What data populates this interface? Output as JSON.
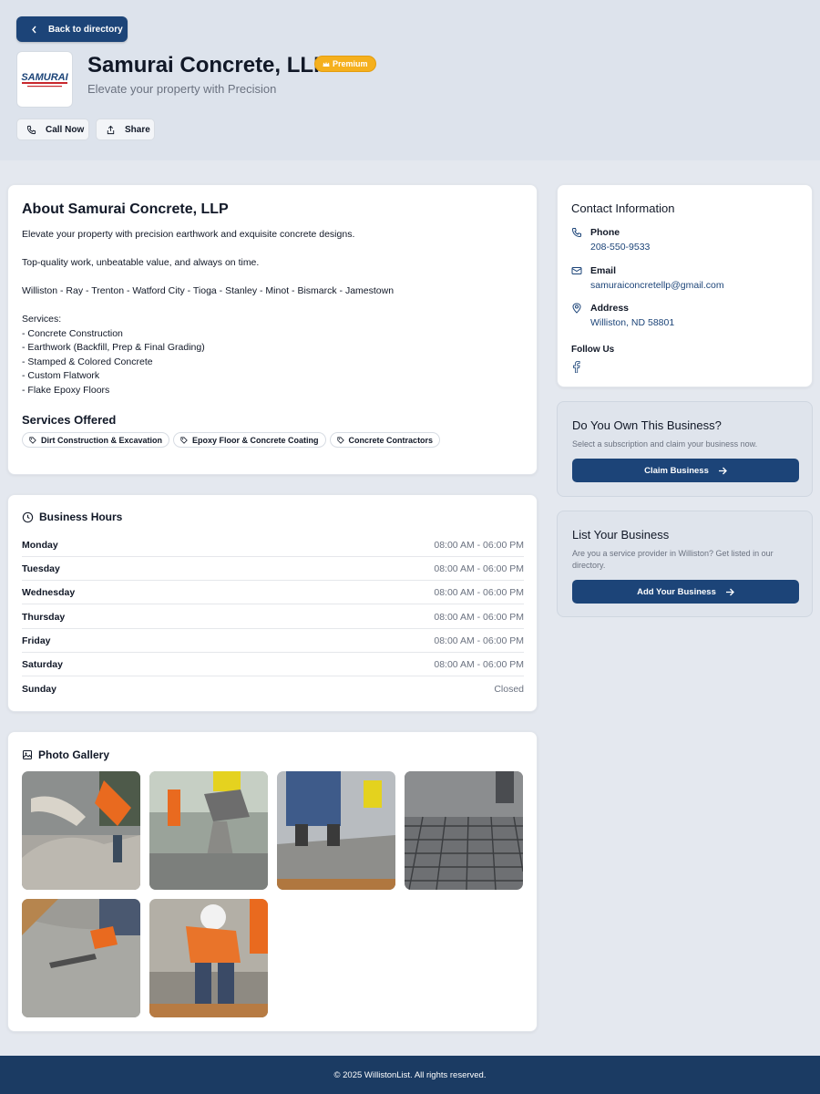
{
  "header": {
    "back_label": "Back to directory",
    "logo_text": "SAMURAI",
    "business_name": "Samurai Concrete, LLP",
    "premium_label": "Premium",
    "tagline": "Elevate your property with Precision",
    "call_label": "Call Now",
    "share_label": "Share"
  },
  "about": {
    "title": "About Samurai Concrete, LLP",
    "description": "Elevate your property with precision earthwork and exquisite concrete designs.\n\nTop-quality work, unbeatable value, and always on time.\n\nWilliston - Ray - Trenton - Watford City - Tioga - Stanley - Minot - Bismarck - Jamestown\n\nServices:\n- Concrete Construction\n- Earthwork (Backfill, Prep & Final Grading)\n- Stamped & Colored Concrete\n- Custom Flatwork\n- Flake Epoxy Floors",
    "services_title": "Services Offered",
    "services": [
      "Dirt Construction & Excavation",
      "Epoxy Floor & Concrete Coating",
      "Concrete Contractors"
    ]
  },
  "hours": {
    "title": "Business Hours",
    "rows": [
      {
        "day": "Monday",
        "time": "08:00 AM - 06:00 PM"
      },
      {
        "day": "Tuesday",
        "time": "08:00 AM - 06:00 PM"
      },
      {
        "day": "Wednesday",
        "time": "08:00 AM - 06:00 PM"
      },
      {
        "day": "Thursday",
        "time": "08:00 AM - 06:00 PM"
      },
      {
        "day": "Friday",
        "time": "08:00 AM - 06:00 PM"
      },
      {
        "day": "Saturday",
        "time": "08:00 AM - 06:00 PM"
      },
      {
        "day": "Sunday",
        "time": "Closed"
      }
    ]
  },
  "gallery": {
    "title": "Photo Gallery"
  },
  "contact": {
    "title": "Contact Information",
    "phone_label": "Phone",
    "phone": "208-550-9533",
    "email_label": "Email",
    "email": "samuraiconcretellp@gmail.com",
    "address_label": "Address",
    "address": "Williston, ND 58801",
    "follow_label": "Follow Us"
  },
  "claim": {
    "title": "Do You Own This Business?",
    "text": "Select a subscription and claim your business now.",
    "button": "Claim Business"
  },
  "list": {
    "title": "List Your Business",
    "text": "Are you a service provider in Williston? Get listed in our directory.",
    "button": "Add Your Business"
  },
  "footer": {
    "text": "© 2025 WillistonList. All rights reserved."
  },
  "colors": {
    "primary": "#1c4478",
    "premium": "#f5b01d",
    "footer": "#1b3b63"
  }
}
